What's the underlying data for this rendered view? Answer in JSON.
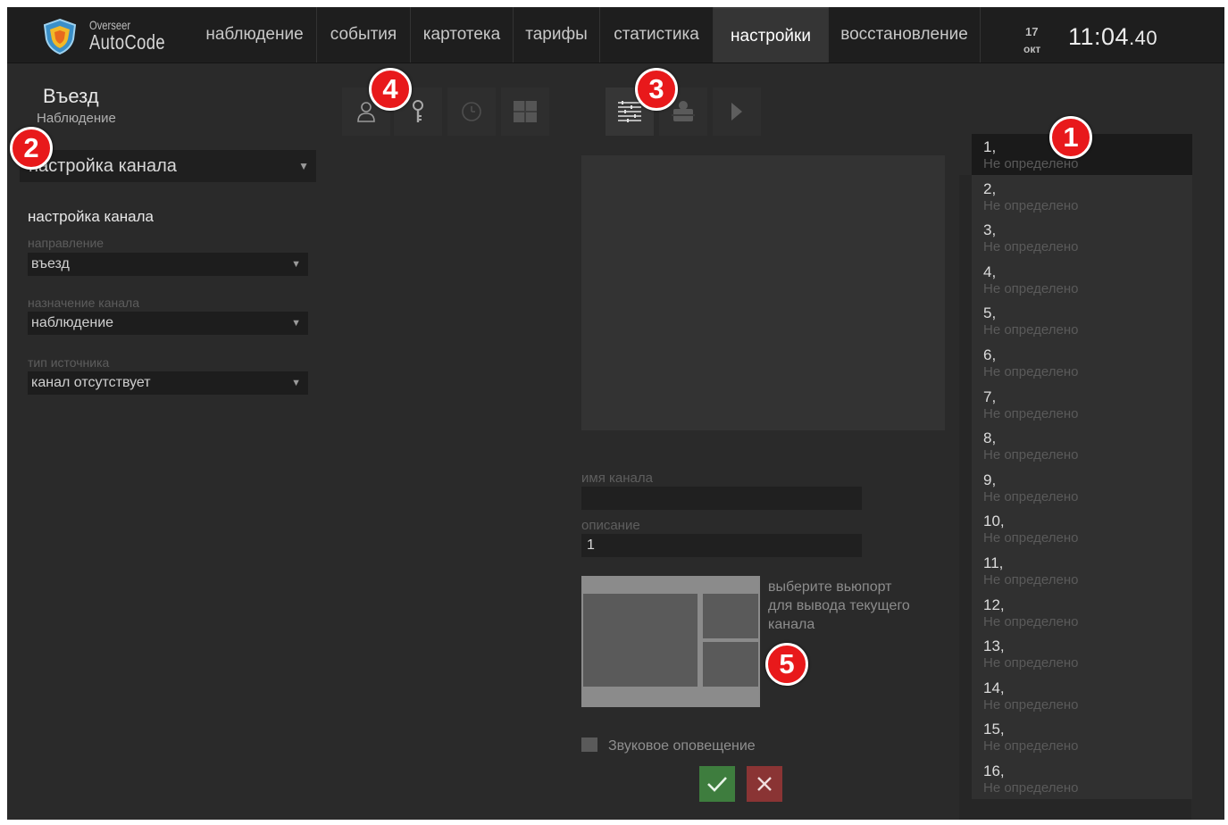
{
  "logo": {
    "line1": "Overseer",
    "line2": "AutoCode"
  },
  "nav": {
    "items": [
      {
        "label": "наблюдение"
      },
      {
        "label": "события"
      },
      {
        "label": "картотека"
      },
      {
        "label": "тарифы"
      },
      {
        "label": "статистика"
      },
      {
        "label": "настройки",
        "active": true
      },
      {
        "label": "восстановление"
      }
    ]
  },
  "date": {
    "day": "17",
    "month": "окт"
  },
  "clock": {
    "time": "11:04",
    "seconds": ".40"
  },
  "header": {
    "title": "Въезд",
    "subtitle": "Наблюдение"
  },
  "toolbar": {
    "left_icons": [
      "user-icon",
      "key-icon",
      "clock-icon",
      "grid-icon"
    ],
    "right_icons": [
      "settings-list-icon",
      "camera-icon",
      "play-icon"
    ]
  },
  "markers": [
    "1",
    "2",
    "3",
    "4",
    "5"
  ],
  "left_panel": {
    "mode_select": "настройка канала",
    "section_title": "настройка канала",
    "direction_label": "направление",
    "direction_value": "въезд",
    "purpose_label": "назначение канала",
    "purpose_value": "наблюдение",
    "source_label": "тип источника",
    "source_value": "канал отсутствует"
  },
  "center_panel": {
    "name_label": "имя канала",
    "name_value": "",
    "description_label": "описание",
    "description_value": "1",
    "viewport_hint": "выберите вьюпорт для вывода текущего канала",
    "sound_label": "Звуковое оповещение",
    "sound_checked": false
  },
  "channels": [
    {
      "number": "1,",
      "status": "Не определено",
      "selected": true
    },
    {
      "number": "2,",
      "status": "Не определено"
    },
    {
      "number": "3,",
      "status": "Не определено"
    },
    {
      "number": "4,",
      "status": "Не определено"
    },
    {
      "number": "5,",
      "status": "Не определено"
    },
    {
      "number": "6,",
      "status": "Не определено"
    },
    {
      "number": "7,",
      "status": "Не определено"
    },
    {
      "number": "8,",
      "status": "Не определено"
    },
    {
      "number": "9,",
      "status": "Не определено"
    },
    {
      "number": "10,",
      "status": "Не определено"
    },
    {
      "number": "11,",
      "status": "Не определено"
    },
    {
      "number": "12,",
      "status": "Не определено"
    },
    {
      "number": "13,",
      "status": "Не определено"
    },
    {
      "number": "14,",
      "status": "Не определено"
    },
    {
      "number": "15,",
      "status": "Не определено"
    },
    {
      "number": "16,",
      "status": "Не определено"
    }
  ],
  "colors": {
    "background": "#2a2a2a",
    "topbar": "#1e1e1e",
    "marker_red": "#e8191b",
    "ok_green": "#3e7d3e",
    "cancel_red": "#8a3434"
  }
}
